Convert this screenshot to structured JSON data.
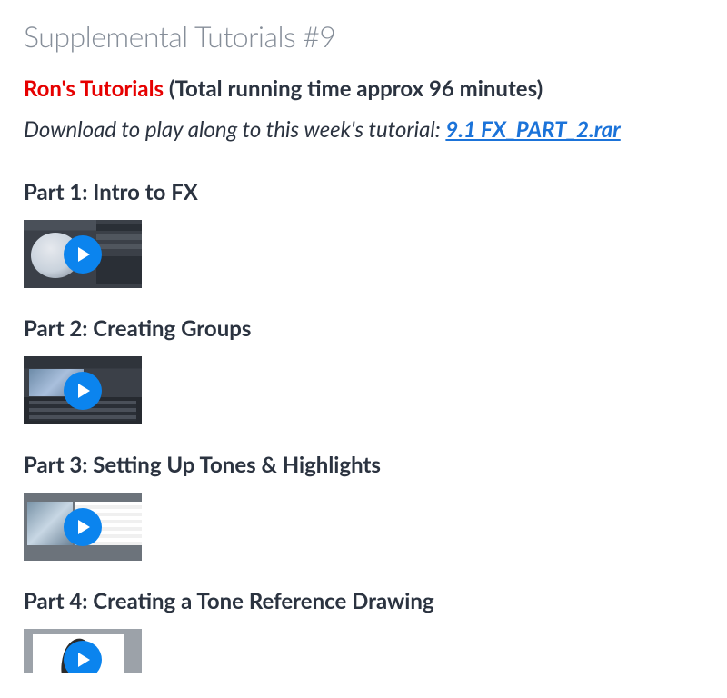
{
  "page_title": "Supplemental Tutorials #9",
  "author_name": "Ron's Tutorials",
  "running_time_text": " (Total running time approx 96 minutes)",
  "download_prefix": "Download to play along to this week's tutorial: ",
  "download_link_text": "9.1 FX_PART_2.rar",
  "parts": [
    {
      "title": "Part 1: Intro to FX"
    },
    {
      "title": "Part 2: Creating Groups"
    },
    {
      "title": "Part 3: Setting Up Tones & Highlights"
    },
    {
      "title": "Part 4: Creating a Tone Reference Drawing"
    }
  ]
}
